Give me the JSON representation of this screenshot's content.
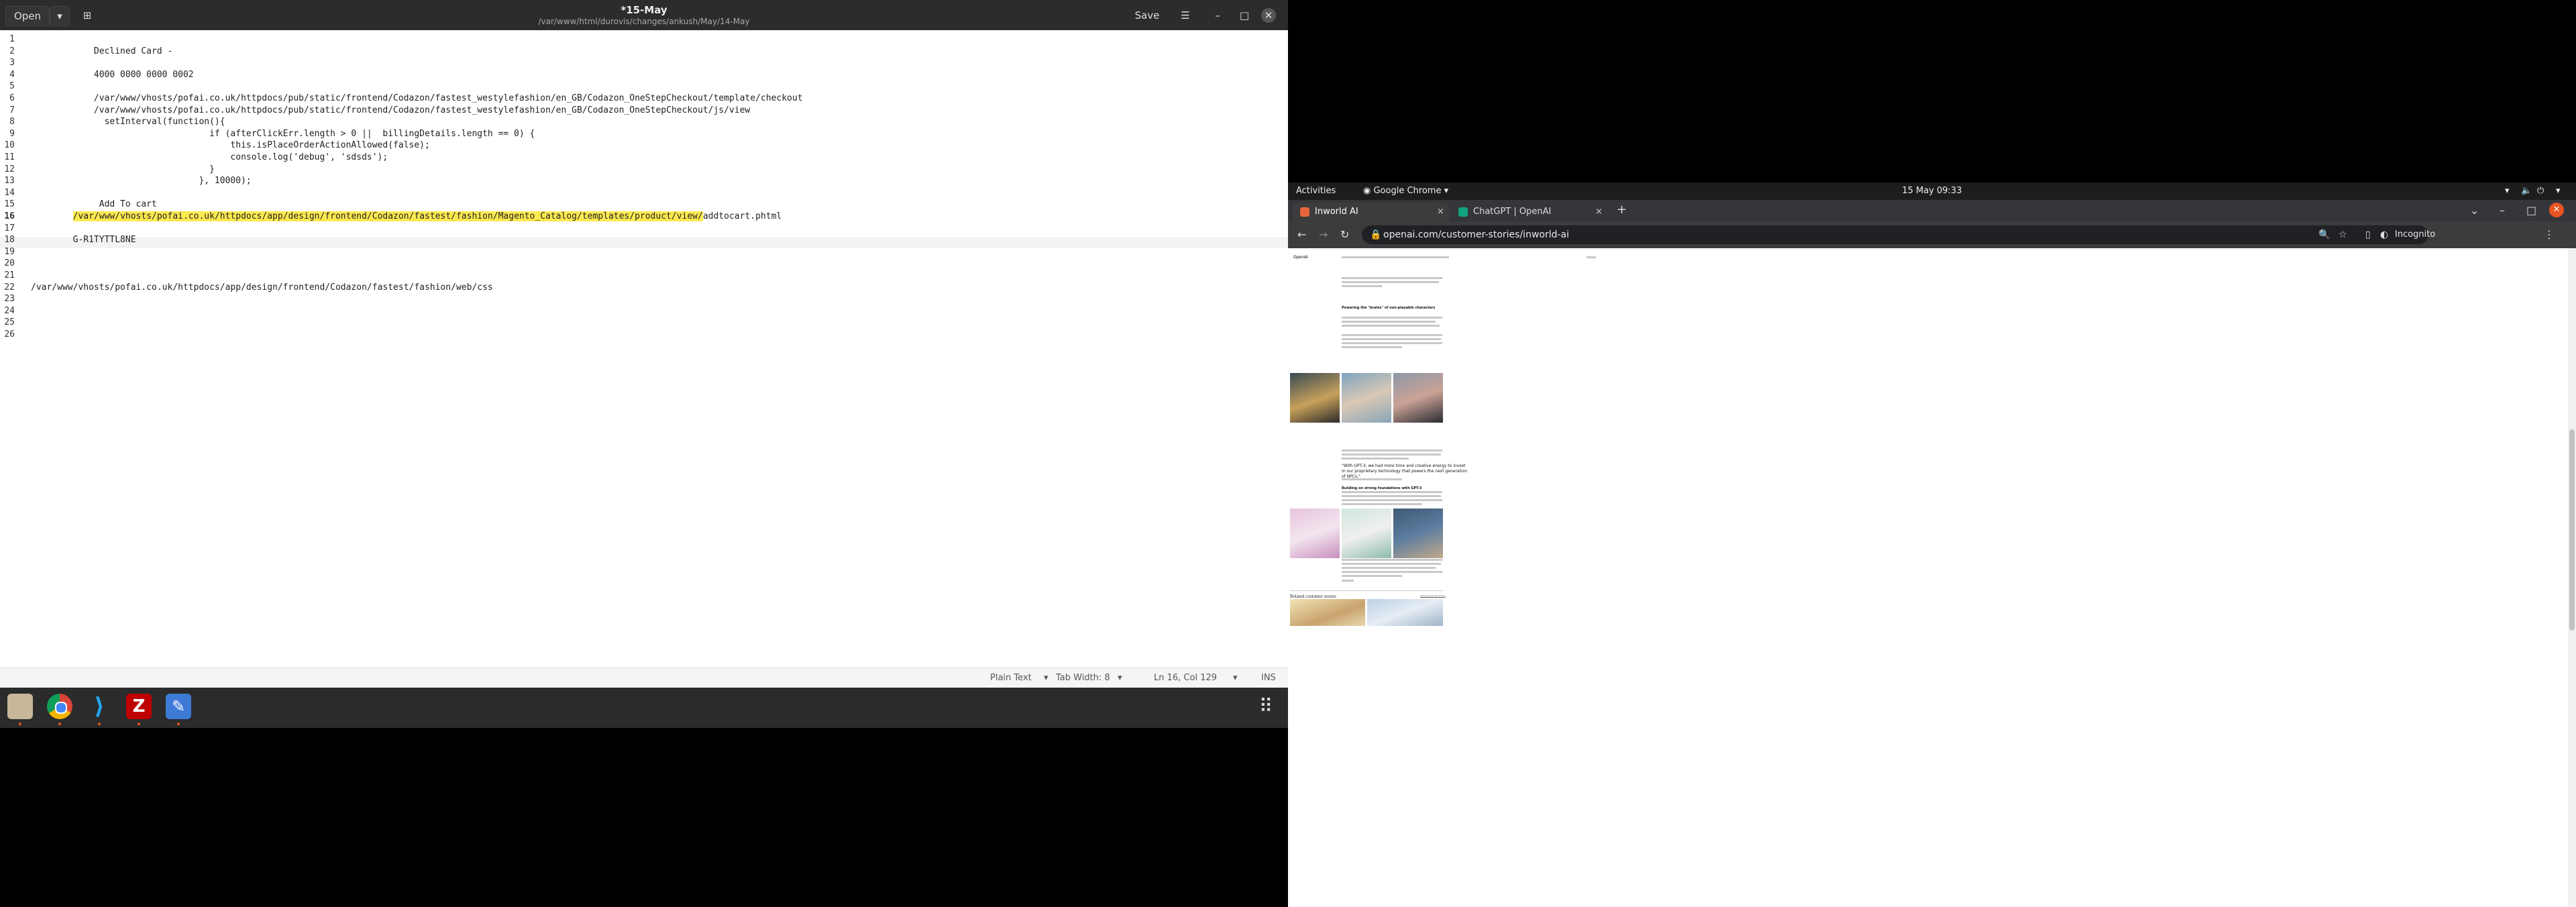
{
  "gedit": {
    "open_label": "Open",
    "title": "*15-May",
    "subtitle": "/var/www/html/durovis/changes/ankush/May/14-May",
    "save_label": "Save",
    "lines": [
      {
        "n": "1",
        "text": ""
      },
      {
        "n": "2",
        "text": "            Declined Card -"
      },
      {
        "n": "3",
        "text": ""
      },
      {
        "n": "4",
        "text": "            4000 0000 0000 0002"
      },
      {
        "n": "5",
        "text": ""
      },
      {
        "n": "6",
        "text": "            /var/www/vhosts/pofai.co.uk/httpdocs/pub/static/frontend/Codazon/fastest_westylefashion/en_GB/Codazon_OneStepCheckout/template/checkout"
      },
      {
        "n": "7",
        "text": "            /var/www/vhosts/pofai.co.uk/httpdocs/pub/static/frontend/Codazon/fastest_westylefashion/en_GB/Codazon_OneStepCheckout/js/view"
      },
      {
        "n": "8",
        "text": "              setInterval(function(){"
      },
      {
        "n": "9",
        "text": "                                  if (afterClickErr.length > 0 ||  billingDetails.length == 0) {"
      },
      {
        "n": "10",
        "text": "                                      this.isPlaceOrderActionAllowed(false);"
      },
      {
        "n": "11",
        "text": "                                      console.log('debug', 'sdsds');"
      },
      {
        "n": "12",
        "text": "                                  }"
      },
      {
        "n": "13",
        "text": "                                }, 10000);"
      },
      {
        "n": "14",
        "text": ""
      },
      {
        "n": "15",
        "text": "             Add To cart"
      },
      {
        "n": "16",
        "text": ""
      },
      {
        "n": "17",
        "text": ""
      },
      {
        "n": "18",
        "text": "        G-R1TYTTL8NE"
      },
      {
        "n": "19",
        "text": ""
      },
      {
        "n": "20",
        "text": ""
      },
      {
        "n": "21",
        "text": ""
      },
      {
        "n": "22",
        "text": "/var/www/vhosts/pofai.co.uk/httpdocs/app/design/frontend/Codazon/fastest/fashion/web/css"
      },
      {
        "n": "23",
        "text": ""
      },
      {
        "n": "24",
        "text": ""
      },
      {
        "n": "25",
        "text": ""
      },
      {
        "n": "26",
        "text": ""
      }
    ],
    "line16_highlight": "/var/www/vhosts/pofai.co.uk/httpdocs/app/design/frontend/Codazon/fastest/fashion/Magento_Catalog/templates/product/view/",
    "line16_rest": "addtocart.phtml",
    "status": {
      "lang": "Plain Text",
      "tab": "Tab Width: 8",
      "pos": "Ln 16, Col 129",
      "mode": "INS"
    }
  },
  "gnome": {
    "activities": "Activities",
    "app": "Google Chrome",
    "clock": "15 May  09:33"
  },
  "chrome": {
    "tabs": [
      {
        "label": "Inworld AI"
      },
      {
        "label": "ChatGPT | OpenAI"
      }
    ],
    "url": "openai.com/customer-stories/inworld-ai",
    "profile": "Incognito"
  },
  "page": {
    "nav_brand": "OpenAI",
    "heading1": "Powering the \"brains\" of non-playable characters",
    "quote": "\"With GPT-3, we had more time and creative energy to invest in our proprietary technology that powers the next generation of NPCs.\"",
    "heading2": "Building on strong foundations with GPT-3",
    "related": "Related customer stories",
    "view_all": "View all customer stories"
  },
  "colors": {
    "accent": "#e95420",
    "highlight": "#fce94f"
  }
}
